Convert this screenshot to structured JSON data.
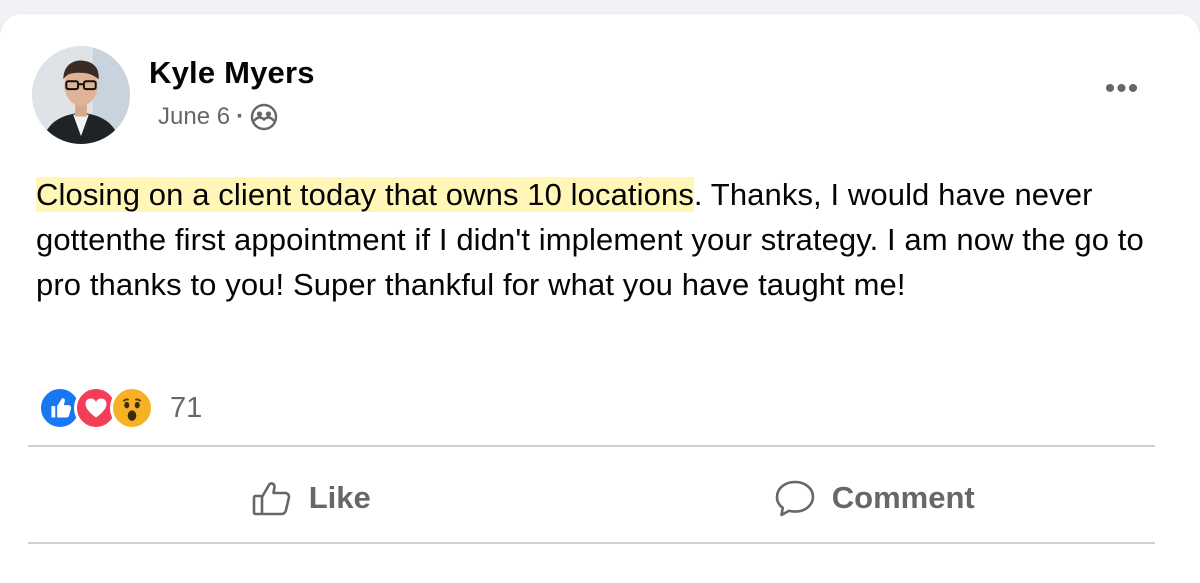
{
  "post": {
    "author": "Kyle Myers",
    "date": "June 6",
    "separator": "·",
    "privacy_icon": "friends-icon",
    "more_icon": "more-dots-icon",
    "more_label": "•••",
    "text_highlighted": "Closing on a client today that owns 10 locations",
    "text_rest": ". Thanks, I would have never gottenthe first appointment if I didn't implement your strategy. I am now the go to pro thanks to you! Super thankful for what you have taught me!",
    "highlight_color": "#fff6b8"
  },
  "reactions": {
    "icons": [
      "like-reaction-icon",
      "love-reaction-icon",
      "wow-reaction-icon"
    ],
    "count": "71"
  },
  "actions": {
    "like_label": "Like",
    "like_icon": "thumbs-up-icon",
    "comment_label": "Comment",
    "comment_icon": "comment-bubble-icon"
  },
  "colors": {
    "like_blue": "#1877f2",
    "love_red": "#f33e58",
    "wow_yellow": "#f7b125",
    "secondary_text": "#65676b",
    "primary_text": "#050505"
  }
}
